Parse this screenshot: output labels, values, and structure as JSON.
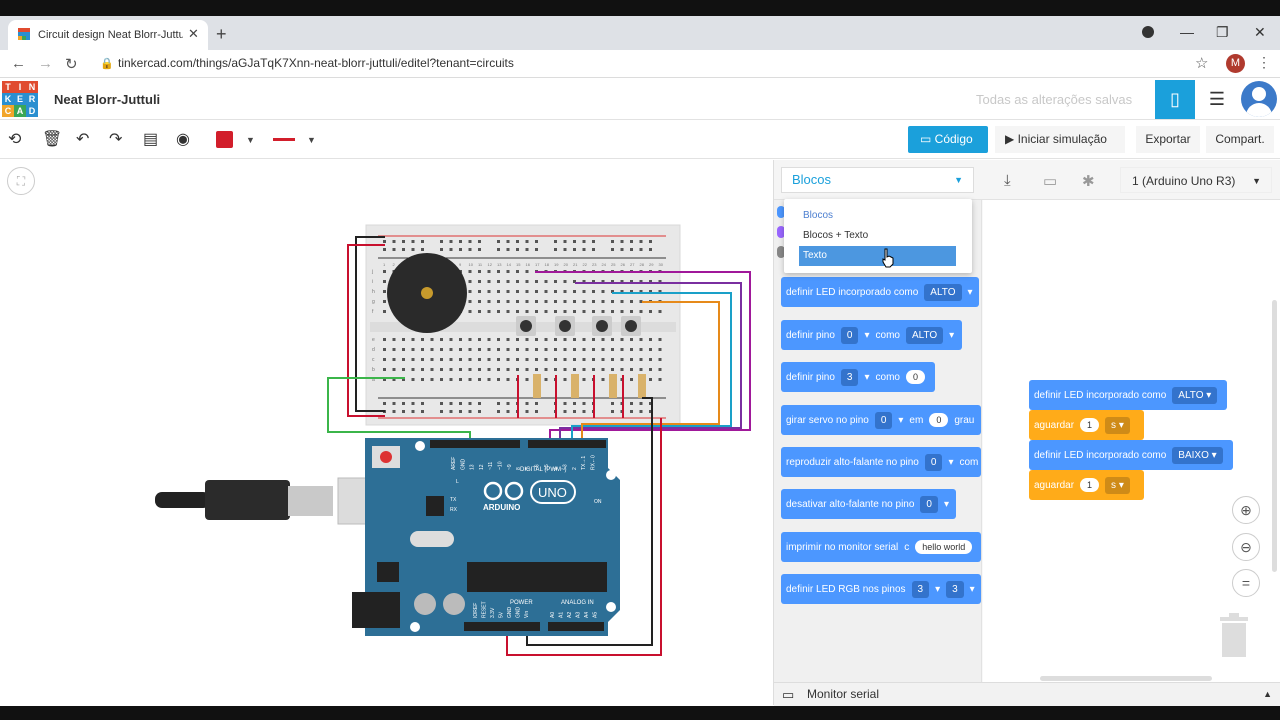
{
  "browser": {
    "tab_title": "Circuit design Neat Blorr-Juttuli |",
    "tab_close": "✕",
    "new_tab": "+",
    "url": "tinkercad.com/things/aGJaTqK7Xnn-neat-blorr-juttuli/editel?tenant=circuits",
    "profile_initial": "M",
    "win_min": "—",
    "win_max": "❐",
    "win_close": "✕"
  },
  "app": {
    "logo_letters": [
      "T",
      "I",
      "N",
      "K",
      "E",
      "R",
      "C",
      "A",
      "D"
    ],
    "logo_colors": [
      "#e04b2f",
      "#e04b2f",
      "#e04b2f",
      "#2a8fd0",
      "#2a8fd0",
      "#2a8fd0",
      "#f1a52b",
      "#3aa656",
      "#2a8fd0"
    ],
    "project_title": "Neat Blorr-Juttuli",
    "save_status": "Todas as alterações salvas"
  },
  "toolbar": {
    "codigo_label": "Código",
    "sim_label": "Iniciar simulação",
    "export_label": "Exportar",
    "share_label": "Compart.",
    "fill_color": "#d21e2b"
  },
  "code_panel": {
    "mode_value": "Blocos",
    "mode_options": [
      "Blocos",
      "Blocos + Texto",
      "Texto"
    ],
    "selected_option": "Texto",
    "board_label": "1 (Arduino Uno R3)",
    "serial_label": "Monitor serial"
  },
  "palette": [
    {
      "text": "definir LED incorporado como",
      "dd": "ALTO"
    },
    {
      "text": "definir pino",
      "dd": "0",
      "text2": "como",
      "dd2": "ALTO"
    },
    {
      "text": "definir pino",
      "dd": "3",
      "text2": "como",
      "pill": "0"
    },
    {
      "text": "girar servo no pino",
      "dd": "0",
      "text2": "em",
      "pill": "0",
      "text3": "grau"
    },
    {
      "text": "reproduzir alto-falante no pino",
      "dd": "0",
      "text2": "com"
    },
    {
      "text": "desativar alto-falante no pino",
      "dd": "0"
    },
    {
      "text": "imprimir no monitor serial",
      "pill": "hello world",
      "text2": "c"
    },
    {
      "text": "definir LED RGB nos pinos",
      "dd": "3",
      "dd2": "3"
    }
  ],
  "workspace": {
    "led_on_text": "definir LED incorporado como",
    "led_on_value": "ALTO",
    "wait1_text": "aguardar",
    "wait1_value": "1",
    "wait1_unit": "s",
    "led_off_text": "definir LED incorporado como",
    "led_off_value": "BAIXO",
    "wait2_text": "aguardar",
    "wait2_value": "1",
    "wait2_unit": "s"
  },
  "arduino": {
    "brand": "ARDUINO",
    "model": "UNO",
    "digital_label": "DIGITAL (PWM~)",
    "power_label": "POWER",
    "analog_label": "ANALOG IN",
    "on_label": "ON",
    "digital_pins": [
      "AREF",
      "GND",
      "13",
      "12",
      "~11",
      "~10",
      "~9",
      "8",
      "7",
      "~6",
      "~5",
      "4",
      "~3",
      "2",
      "TX→1",
      "RX←0"
    ],
    "power_pins": [
      "IOREF",
      "RESET",
      "3.3V",
      "5V",
      "GND",
      "GND",
      "Vin"
    ],
    "analog_pins": [
      "A0",
      "A1",
      "A2",
      "A3",
      "A4",
      "A5"
    ],
    "tx_label": "TX",
    "rx_label": "RX",
    "l_label": "L"
  },
  "breadboard": {
    "column_numbers": [
      "1",
      "2",
      "3",
      "4",
      "5",
      "6",
      "7",
      "8",
      "9",
      "10",
      "11",
      "12",
      "13",
      "14",
      "15",
      "16",
      "17",
      "18",
      "19",
      "20",
      "21",
      "22",
      "23",
      "24",
      "25",
      "26",
      "27",
      "28",
      "29",
      "30"
    ],
    "row_letters_top": [
      "j",
      "i",
      "h",
      "g",
      "f"
    ],
    "row_letters_bottom": [
      "e",
      "d",
      "c",
      "b",
      "a"
    ]
  }
}
